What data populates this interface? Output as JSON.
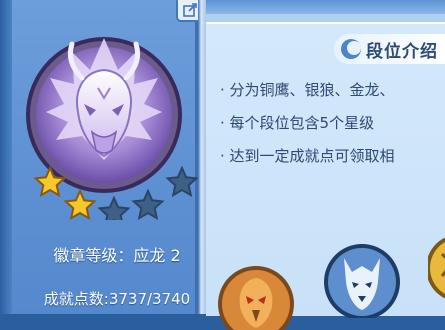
{
  "badge": {
    "name": "dragon-badge",
    "level_label": "徽章等级：应龙 2",
    "stars_filled": 2,
    "stars_total": 5
  },
  "points": {
    "label": "成就点数:3737/3740",
    "current": 3737,
    "max": 3740
  },
  "info": {
    "title": "段位介绍",
    "bullets": [
      "· 分为铜鹰、银狼、金龙、",
      "· 每个段位包含5个星级",
      "· 达到一定成就点可领取相"
    ]
  },
  "rank_icons": [
    "eagle-rank-icon",
    "wolf-rank-icon",
    "gold-rank-icon"
  ],
  "colors": {
    "star_gold": "#f7c82a",
    "star_empty": "#3e5f86",
    "panel_blue": "#6c9edb"
  }
}
